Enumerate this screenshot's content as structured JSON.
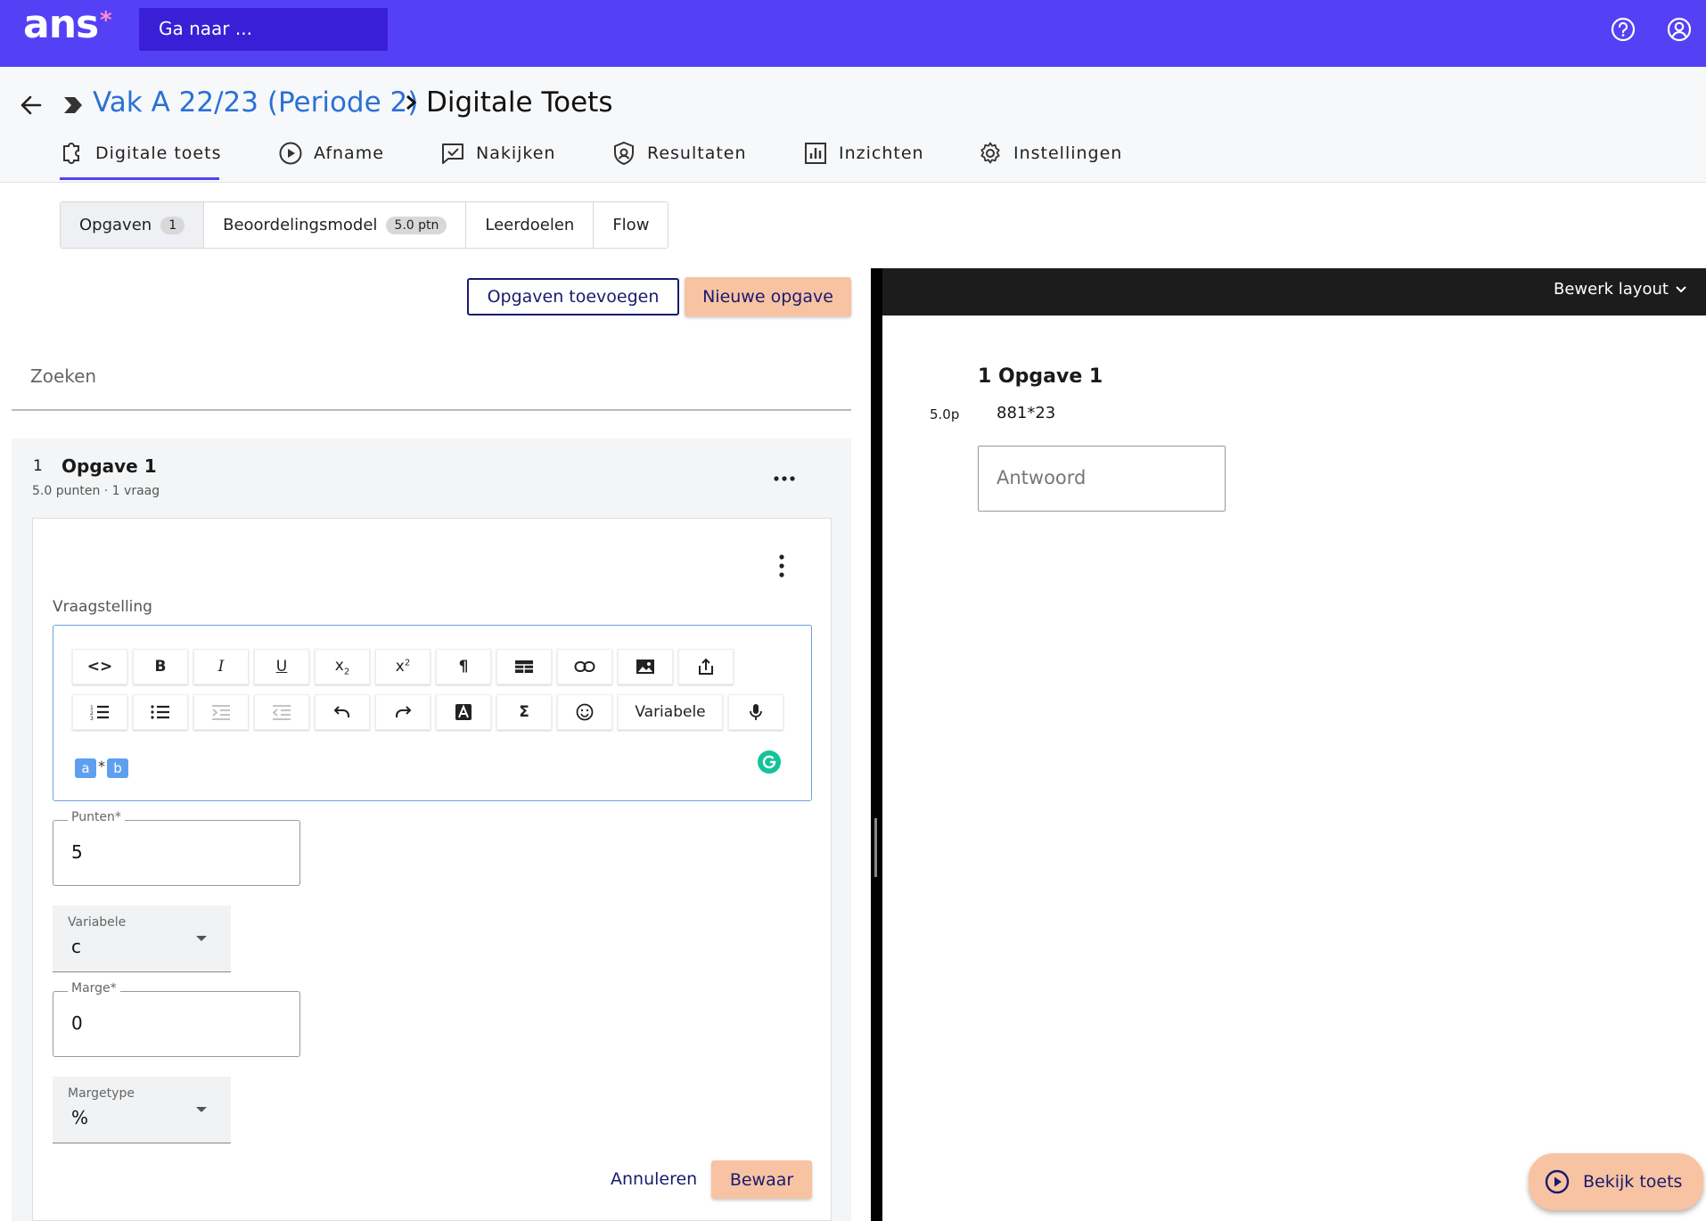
{
  "app": {
    "logo": "ans",
    "logo_star": "*",
    "search_placeholder": "Ga naar ..."
  },
  "breadcrumb": {
    "course": "Vak A 22/23 (Periode 2)",
    "current": "Digitale Toets"
  },
  "tabs": [
    {
      "label": "Digitale toets",
      "icon": "puzzle-icon",
      "active": true
    },
    {
      "label": "Afname",
      "icon": "play-circle-icon"
    },
    {
      "label": "Nakijken",
      "icon": "chat-check-icon"
    },
    {
      "label": "Resultaten",
      "icon": "shield-icon"
    },
    {
      "label": "Inzichten",
      "icon": "bar-chart-icon"
    },
    {
      "label": "Instellingen",
      "icon": "gear-icon"
    }
  ],
  "subtabs": [
    {
      "label": "Opgaven",
      "badge": "1",
      "active": true
    },
    {
      "label": "Beoordelingsmodel",
      "badge": "5.0 ptn"
    },
    {
      "label": "Leerdoelen"
    },
    {
      "label": "Flow"
    }
  ],
  "actions": {
    "add_label": "Opgaven toevoegen",
    "new_label": "Nieuwe opgave"
  },
  "search": {
    "placeholder": "Zoeken"
  },
  "question": {
    "number": "1",
    "title": "Opgave 1",
    "meta": "5.0 punten · 1 vraag"
  },
  "editor": {
    "label": "Vraagstelling",
    "variable_button": "Variabele",
    "chip_a": "a",
    "chip_op": "*",
    "chip_b": "b"
  },
  "fields": {
    "punten": {
      "label": "Punten*",
      "value": "5"
    },
    "variabele": {
      "label": "Variabele",
      "value": "c"
    },
    "marge": {
      "label": "Marge*",
      "value": "0"
    },
    "margetype": {
      "label": "Margetype",
      "value": "%"
    }
  },
  "form_actions": {
    "cancel": "Annuleren",
    "save": "Bewaar"
  },
  "preview": {
    "layout_label": "Bewerk layout",
    "title": "1 Opgave 1",
    "points": "5.0p",
    "question": "881*23",
    "answer_placeholder": "Antwoord",
    "view_button": "Bekijk toets"
  },
  "colors": {
    "brand": "#5441f5",
    "accent": "#f7c3a2",
    "link": "#2a70d5",
    "navy": "#1a1a6e"
  }
}
